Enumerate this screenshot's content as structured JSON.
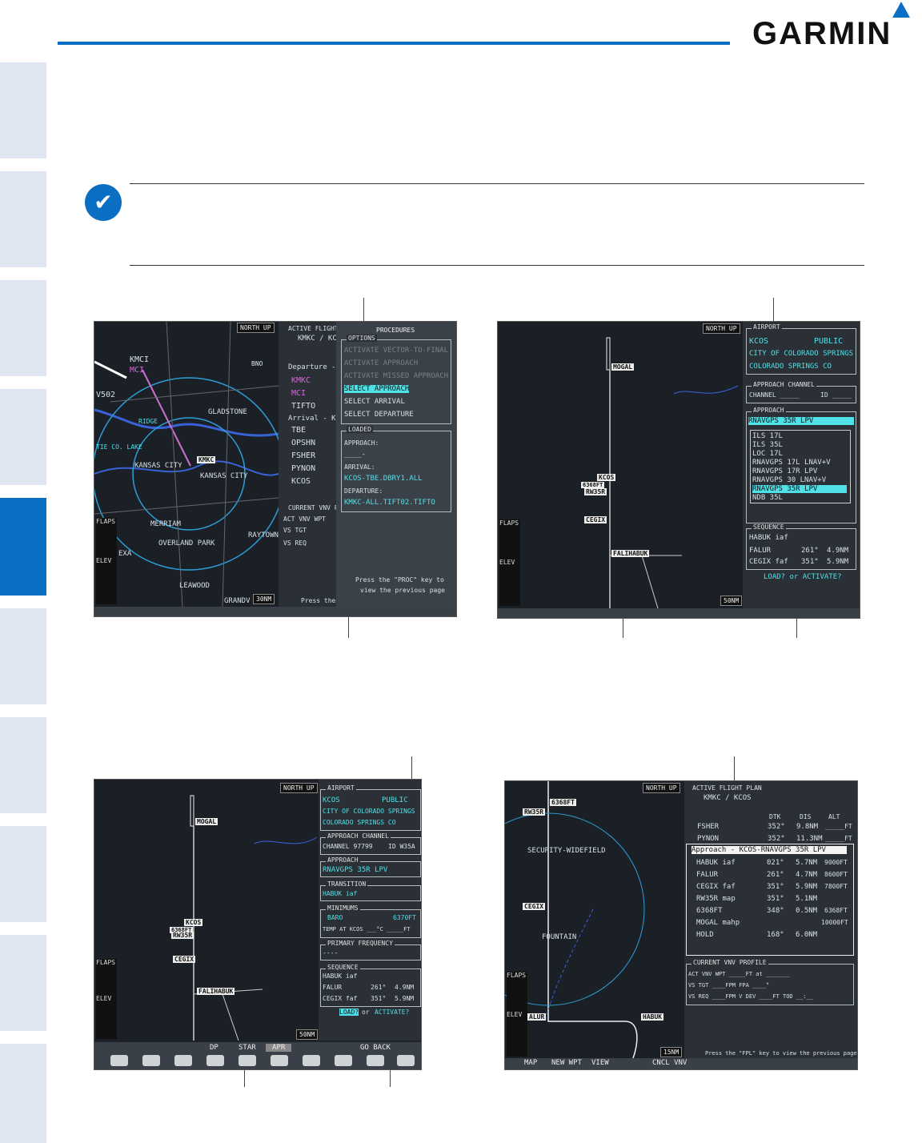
{
  "brand": {
    "logo_text": "GARMIN",
    "accent": "#0a6fc2"
  },
  "note_icon": "note-checkmark-icon",
  "screen1": {
    "north_up": "NORTH UP",
    "map_labels": [
      "KMCI",
      "MCI",
      "V502",
      "BNO",
      "GLADSTONE",
      "KANSAS CITY",
      "KMKC",
      "KANSAS CITY",
      "MERRIAM",
      "OVERLAND PARK",
      "RAYTOWN",
      "LEAWOOD",
      "GRANDV",
      "EXA",
      "RIDGE",
      "TIE CO. LAKE"
    ],
    "range": "30NM",
    "afp_title": "ACTIVE FLIGHT",
    "afp_route": "KMKC / KC",
    "departure": "Departure - K",
    "dep_wpts": [
      "KMKC",
      "MCI",
      "TIFTO"
    ],
    "arrival": "Arrival - KCOS",
    "arr_wpts": [
      "TBE",
      "OPSHN",
      "FSHER",
      "PYNON",
      "KCOS"
    ],
    "vnav_title": "CURRENT VNV P",
    "vnav_rows": [
      "ACT VNV WPT",
      "VS TGT",
      "VS REQ"
    ],
    "flaps": "FLAPS",
    "elev": "ELEV",
    "proc_title": "PROCEDURES",
    "options_title": "OPTIONS",
    "options": [
      "ACTIVATE VECTOR-TO-FINAL",
      "ACTIVATE APPROACH",
      "ACTIVATE MISSED APPROACH",
      "SELECT APPROACH",
      "SELECT ARRIVAL",
      "SELECT DEPARTURE"
    ],
    "loaded_title": "LOADED",
    "approach_label": "APPROACH:",
    "approach_val": "____-",
    "arrival_label": "ARRIVAL:",
    "arrival_val": "KCOS-TBE.DBRY1.ALL",
    "departure_label": "DEPARTURE:",
    "departure_val": "KMKC-ALL.TIFT02.TIFTO",
    "press_line1": "Press the \"PROC\" key to",
    "press_line2": "view the previous page",
    "press_cut": "Press the \"F"
  },
  "screen2": {
    "north_up": "NORTH UP",
    "map_labels": [
      "MOGAL",
      "KCOS",
      "6368FT",
      "RW35R",
      "CEGIX",
      "FALIHABUK"
    ],
    "range": "50NM",
    "airport_title": "AIRPORT",
    "airport_id": "KCOS",
    "airport_type": "PUBLIC",
    "airport_city": "CITY OF COLORADO SPRINGS",
    "airport_state": "COLORADO SPRINGS CO",
    "channel_title": "APPROACH CHANNEL",
    "channel": "CHANNEL _____",
    "id": "ID _____",
    "approach_title": "APPROACH",
    "approach_sel": "RNAVGPS 35R LPV",
    "approach_list": [
      "ILS 17L",
      "ILS 35L",
      "LOC 17L",
      "RNAVGPS 17L LNAV+V",
      "RNAVGPS 17R LPV",
      "RNAVGPS 30 LNAV+V",
      "RNAVGPS 35R LPV",
      "NDB 35L"
    ],
    "sequence_title": "SEQUENCE",
    "seq": [
      [
        "HABUK iaf",
        "",
        ""
      ],
      [
        "FALUR",
        "261°",
        "4.9NM"
      ],
      [
        "CEGIX faf",
        "351°",
        "5.9NM"
      ]
    ],
    "load_q": "LOAD? or ACTIVATE?",
    "flaps": "FLAPS",
    "elev": "ELEV"
  },
  "screen3": {
    "north_up": "NORTH UP",
    "map_labels": [
      "MOGAL",
      "KCOS",
      "6368FT",
      "RW35R",
      "CEGIX",
      "FALIHABUK"
    ],
    "range": "50NM",
    "airport_title": "AIRPORT",
    "airport_id": "KCOS",
    "airport_type": "PUBLIC",
    "airport_city": "CITY OF COLORADO SPRINGS",
    "airport_state": "COLORADO SPRINGS CO",
    "channel_title": "APPROACH CHANNEL",
    "channel": "CHANNEL 97799",
    "id": "ID W35A",
    "approach_title": "APPROACH",
    "approach": "RNAVGPS 35R LPV",
    "transition_title": "TRANSITION",
    "transition": "HABUK iaf",
    "minimums_title": "MINIMUMS",
    "minimums_type": "BARO",
    "minimums_val": "6370FT",
    "temp": "TEMP AT KCOS ___°C  _____FT",
    "freq_title": "PRIMARY FREQUENCY",
    "freq": "----",
    "sequence_title": "SEQUENCE",
    "seq": [
      [
        "HABUK iaf",
        "",
        ""
      ],
      [
        "FALUR",
        "261°",
        "4.9NM"
      ],
      [
        "CEGIX faf",
        "351°",
        "5.9NM"
      ]
    ],
    "load_label": "LOAD?",
    "or": "or",
    "activate": "ACTIVATE?",
    "softkeys": [
      "DP",
      "STAR",
      "APR",
      "GO BACK"
    ],
    "flaps": "FLAPS",
    "elev": "ELEV"
  },
  "screen4": {
    "north_up": "NORTH UP",
    "map_labels": [
      "6368FT",
      "RW35R",
      "SECURITY-WIDEFIELD",
      "CEGIX",
      "FOUNTAIN",
      "ALUR",
      "HABUK"
    ],
    "range": "15NM",
    "afp_title": "ACTIVE FLIGHT PLAN",
    "afp_route": "KMKC / KCOS",
    "cols": [
      "DTK",
      "DIS",
      "ALT"
    ],
    "rows_top": [
      [
        "FSHER",
        "352°",
        "9.8NM",
        "_____FT"
      ],
      [
        "PYNON",
        "352°",
        "11.3NM",
        "_____FT"
      ]
    ],
    "approach_header": "Approach - KCOS-RNAVGPS 35R LPV",
    "rows": [
      [
        "HABUK iaf",
        "021°",
        "5.7NM",
        "9000FT"
      ],
      [
        "FALUR",
        "261°",
        "4.7NM",
        "8600FT"
      ],
      [
        "CEGIX faf",
        "351°",
        "5.9NM",
        "7800FT"
      ],
      [
        "RW35R map",
        "351°",
        "5.1NM",
        ""
      ],
      [
        "6368FT",
        "348°",
        "0.5NM",
        "6368FT"
      ],
      [
        "MOGAL mahp",
        "",
        "",
        "10000FT"
      ],
      [
        "HOLD",
        "168°",
        "6.0NM",
        ""
      ]
    ],
    "vnav_title": "CURRENT VNV PROFILE",
    "vnav_rows": [
      "ACT VNV WPT  _____FT at  _______",
      "VS TGT  ____FPM   FPA  ____°",
      "VS REQ  ____FPM   V DEV  ____FT   TOD  __:__"
    ],
    "press": "Press the \"FPL\" key to view the previous page",
    "softkeys": [
      "MAP",
      "NEW WPT",
      "VIEW",
      "CNCL VNV"
    ],
    "flaps": "FLAPS",
    "elev": "ELEV"
  }
}
